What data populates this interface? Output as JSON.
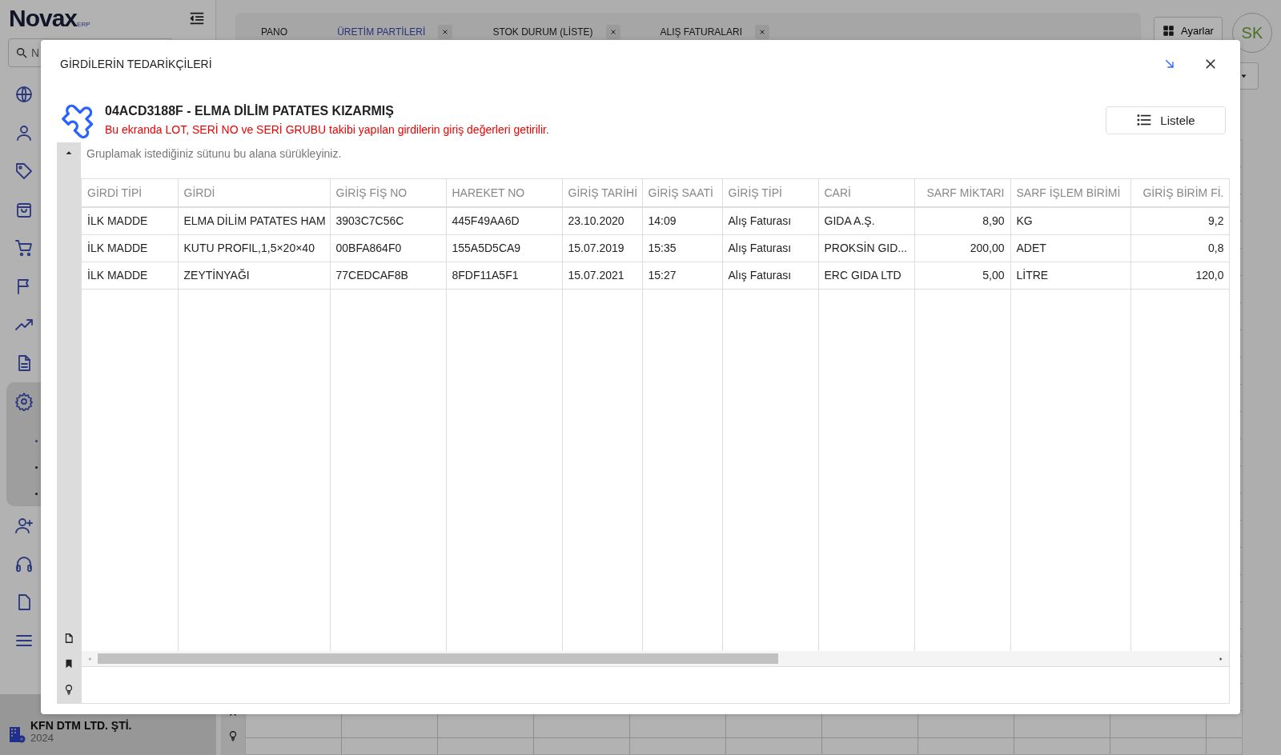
{
  "app": {
    "logo": "Novax",
    "logo_suffix": "ERP",
    "search": {
      "placeholder": "N"
    },
    "sidebar": {
      "items": [
        {
          "expanded": false
        },
        {
          "expanded": false
        },
        {
          "expanded": false
        },
        {
          "expanded": false
        },
        {
          "expanded": false
        },
        {
          "expanded": false
        },
        {
          "expanded": false
        },
        {
          "expanded": false
        },
        {
          "expanded": true,
          "children": [
            {
              "selected": true
            },
            {
              "selected": false
            },
            {
              "selected": false
            }
          ]
        },
        {
          "expanded": false
        },
        {
          "expanded": false
        },
        {
          "expanded": false
        },
        {
          "expanded": false
        }
      ]
    },
    "company": {
      "name": "KFN DTM LTD. ŞTİ.",
      "year": "2024"
    },
    "tabs": [
      {
        "label": "PANO",
        "selected": false,
        "closable": false
      },
      {
        "label": "ÜRETİM PARTİLERİ",
        "selected": true,
        "closable": true
      },
      {
        "label": "STOK DURUM (LİSTE)",
        "selected": false,
        "closable": true
      },
      {
        "label": "ALIŞ FATURALARI",
        "selected": false,
        "closable": true
      }
    ],
    "settings_button": "Ayarlar",
    "avatar": "SK"
  },
  "dialog": {
    "title": "GİRDİLERİN TEDARİKÇİLERİ",
    "heading": "04ACD3188F - ELMA DİLİM PATATES KIZARMIŞ",
    "notice": "Bu ekranda LOT, SERİ NO ve SERİ GRUBU takibi yapılan girdilerin giriş değerleri getirilir.",
    "list_button": "Listele",
    "group_hint": "Gruplamak istediğiniz sütunu bu alana sürükleyiniz.",
    "table": {
      "columns": [
        {
          "label": "GİRDİ TİPİ",
          "kind": "text"
        },
        {
          "label": "GİRDİ",
          "kind": "text"
        },
        {
          "label": "GİRİŞ FİŞ NO",
          "kind": "text"
        },
        {
          "label": "HAREKET NO",
          "kind": "text"
        },
        {
          "label": "GİRİŞ TARİHİ",
          "kind": "text"
        },
        {
          "label": "GİRİŞ SAATİ",
          "kind": "text"
        },
        {
          "label": "GİRİŞ TİPİ",
          "kind": "text"
        },
        {
          "label": "CARİ",
          "kind": "text"
        },
        {
          "label": "SARF MİKTARI",
          "kind": "number"
        },
        {
          "label": "SARF İŞLEM BİRİMİ",
          "kind": "text"
        },
        {
          "label": "GİRİŞ BİRİM Fİ.",
          "kind": "number"
        }
      ],
      "rows": [
        [
          "İLK MADDE",
          "ELMA DİLİM PATATES HAM",
          "3903C7C56C",
          "445F49AA6D",
          "23.10.2020",
          "14:09",
          "Alış Faturası",
          "GIDA A.Ş.",
          "8,90",
          "KG",
          "9,2"
        ],
        [
          "İLK MADDE",
          "KUTU PROFIL,1,5×20×40",
          "00BFA864F0",
          "155A5D5CA9",
          "15.07.2019",
          "15:35",
          "Alış Faturası",
          "PROKSİN GID...",
          "200,00",
          "ADET",
          "0,8"
        ],
        [
          "İLK MADDE",
          "ZEYTİNYAĞI",
          "77CEDCAF8B",
          "8FDF11A5F1",
          "15.07.2021",
          "15:27",
          "Alış Faturası",
          "ERC GIDA LTD",
          "5,00",
          "LİTRE",
          "120,0"
        ]
      ]
    }
  }
}
